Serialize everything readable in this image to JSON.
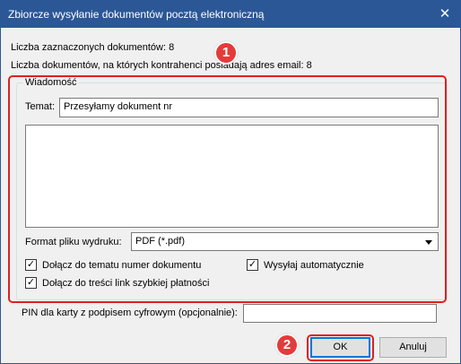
{
  "window": {
    "title": "Zbiorcze wysyłanie dokumentów pocztą elektroniczną",
    "close_glyph": "✕"
  },
  "info": {
    "selected": "Liczba zaznaczonych dokumentów: 8",
    "with_email": "Liczba dokumentów, na których kontrahenci posiadają adres email: 8"
  },
  "message": {
    "group_label": "Wiadomość",
    "subject_label": "Temat:",
    "subject_value": "Przesyłamy dokument nr",
    "body_value": "",
    "format_label": "Format pliku wydruku:",
    "format_value": "PDF (*.pdf)",
    "checkboxes": [
      {
        "label": "Dołącz do tematu numer dokumentu",
        "checked": true
      },
      {
        "label": "Wysyłaj automatycznie",
        "checked": true
      },
      {
        "label": "Dołącz do treści link szybkiej płatności",
        "checked": true
      }
    ]
  },
  "pin": {
    "label": "PIN dla karty z podpisem cyfrowym (opcjonalnie):",
    "value": ""
  },
  "buttons": {
    "ok": "OK",
    "cancel": "Anuluj"
  },
  "annotations": {
    "badge1": "1",
    "badge2": "2",
    "color": "#e02020"
  },
  "colors": {
    "titlebar": "#2b5797",
    "client": "#f0f0f0"
  }
}
